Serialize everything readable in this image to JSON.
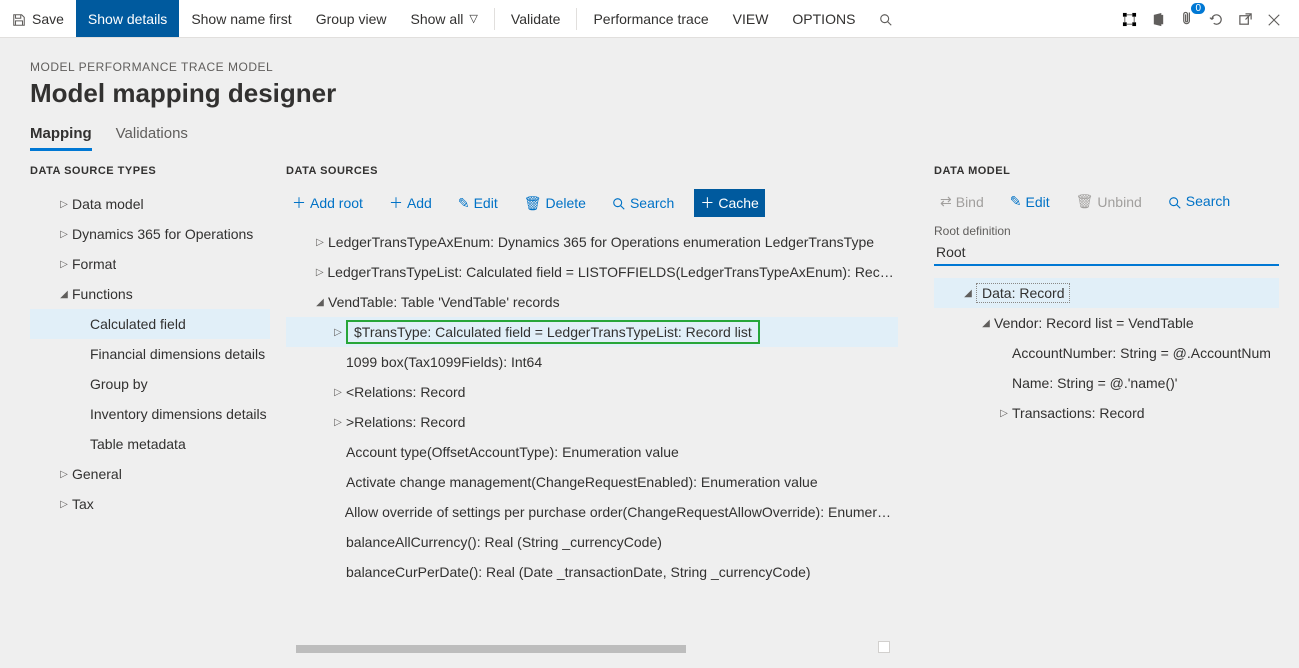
{
  "ribbon": {
    "save": "Save",
    "show_details": "Show details",
    "show_name_first": "Show name first",
    "group_view": "Group view",
    "show_all": "Show all",
    "validate": "Validate",
    "perf_trace": "Performance trace",
    "view": "VIEW",
    "options": "OPTIONS"
  },
  "header": {
    "breadcrumb": "MODEL PERFORMANCE TRACE MODEL",
    "title": "Model mapping designer"
  },
  "tabs": {
    "mapping": "Mapping",
    "validations": "Validations"
  },
  "dst": {
    "heading": "DATA SOURCE TYPES",
    "items": [
      {
        "label": "Data model",
        "chev": "▷",
        "indent": 1
      },
      {
        "label": "Dynamics 365 for Operations",
        "chev": "▷",
        "indent": 1
      },
      {
        "label": "Format",
        "chev": "▷",
        "indent": 1
      },
      {
        "label": "Functions",
        "chev": "◢",
        "indent": 1
      },
      {
        "label": "Calculated field",
        "chev": "",
        "indent": 2,
        "sel": true
      },
      {
        "label": "Financial dimensions details",
        "chev": "",
        "indent": 2
      },
      {
        "label": "Group by",
        "chev": "",
        "indent": 2
      },
      {
        "label": "Inventory dimensions details",
        "chev": "",
        "indent": 2
      },
      {
        "label": "Table metadata",
        "chev": "",
        "indent": 2
      },
      {
        "label": "General",
        "chev": "▷",
        "indent": 1
      },
      {
        "label": "Tax",
        "chev": "▷",
        "indent": 1
      }
    ]
  },
  "ds": {
    "heading": "DATA SOURCES",
    "toolbar": {
      "add_root": "Add root",
      "add": "Add",
      "edit": "Edit",
      "delete": "Delete",
      "search": "Search",
      "cache": "Cache"
    },
    "items": [
      {
        "label": "LedgerTransTypeAxEnum: Dynamics 365 for Operations enumeration LedgerTransType",
        "chev": "▷",
        "indent": 1
      },
      {
        "label": "LedgerTransTypeList: Calculated field = LISTOFFIELDS(LedgerTransTypeAxEnum): Record list",
        "chev": "▷",
        "indent": 1
      },
      {
        "label": "VendTable: Table 'VendTable' records",
        "chev": "◢",
        "indent": 1
      },
      {
        "label": "$TransType: Calculated field = LedgerTransTypeList: Record list",
        "chev": "▷",
        "indent": 2,
        "sel": true,
        "boxed": true
      },
      {
        "label": "1099 box(Tax1099Fields): Int64",
        "chev": "",
        "indent": 2
      },
      {
        "label": "<Relations: Record",
        "chev": "▷",
        "indent": 2
      },
      {
        "label": ">Relations: Record",
        "chev": "▷",
        "indent": 2
      },
      {
        "label": "Account type(OffsetAccountType): Enumeration value",
        "chev": "",
        "indent": 2
      },
      {
        "label": "Activate change management(ChangeRequestEnabled): Enumeration value",
        "chev": "",
        "indent": 2
      },
      {
        "label": "Allow override of settings per purchase order(ChangeRequestAllowOverride): Enumeration value",
        "chev": "",
        "indent": 2
      },
      {
        "label": "balanceAllCurrency(): Real (String _currencyCode)",
        "chev": "",
        "indent": 2
      },
      {
        "label": "balanceCurPerDate(): Real (Date _transactionDate, String _currencyCode)",
        "chev": "",
        "indent": 2
      }
    ]
  },
  "dm": {
    "heading": "DATA MODEL",
    "toolbar": {
      "bind": "Bind",
      "edit": "Edit",
      "unbind": "Unbind",
      "search": "Search"
    },
    "rootdef_lbl": "Root definition",
    "rootdef_val": "Root",
    "items": [
      {
        "label": "Data: Record",
        "chev": "◢",
        "indent": 1,
        "sel": true,
        "dashed": true
      },
      {
        "label": "Vendor: Record list = VendTable",
        "chev": "◢",
        "indent": 2
      },
      {
        "label": "AccountNumber: String = @.AccountNum",
        "chev": "",
        "indent": 3
      },
      {
        "label": "Name: String = @.'name()'",
        "chev": "",
        "indent": 3
      },
      {
        "label": "Transactions: Record",
        "chev": "▷",
        "indent": 3
      }
    ]
  },
  "badge_count": "0"
}
